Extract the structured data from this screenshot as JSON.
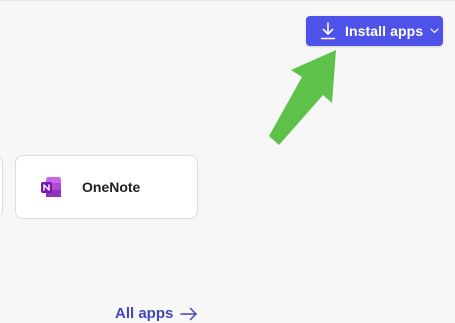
{
  "toolbar": {
    "install_label": "Install apps",
    "install_icon": "download-icon",
    "dropdown_icon": "chevron-down-icon"
  },
  "apps": [
    {
      "name": "OneNote",
      "icon": "onenote-icon"
    }
  ],
  "links": {
    "all_apps_label": "All apps",
    "all_apps_icon": "arrow-right-icon"
  },
  "colors": {
    "accent": "#4f52e8",
    "link": "#4347b8",
    "annotation_arrow": "#5ec24a",
    "onenote_purple": "#7719aa"
  }
}
